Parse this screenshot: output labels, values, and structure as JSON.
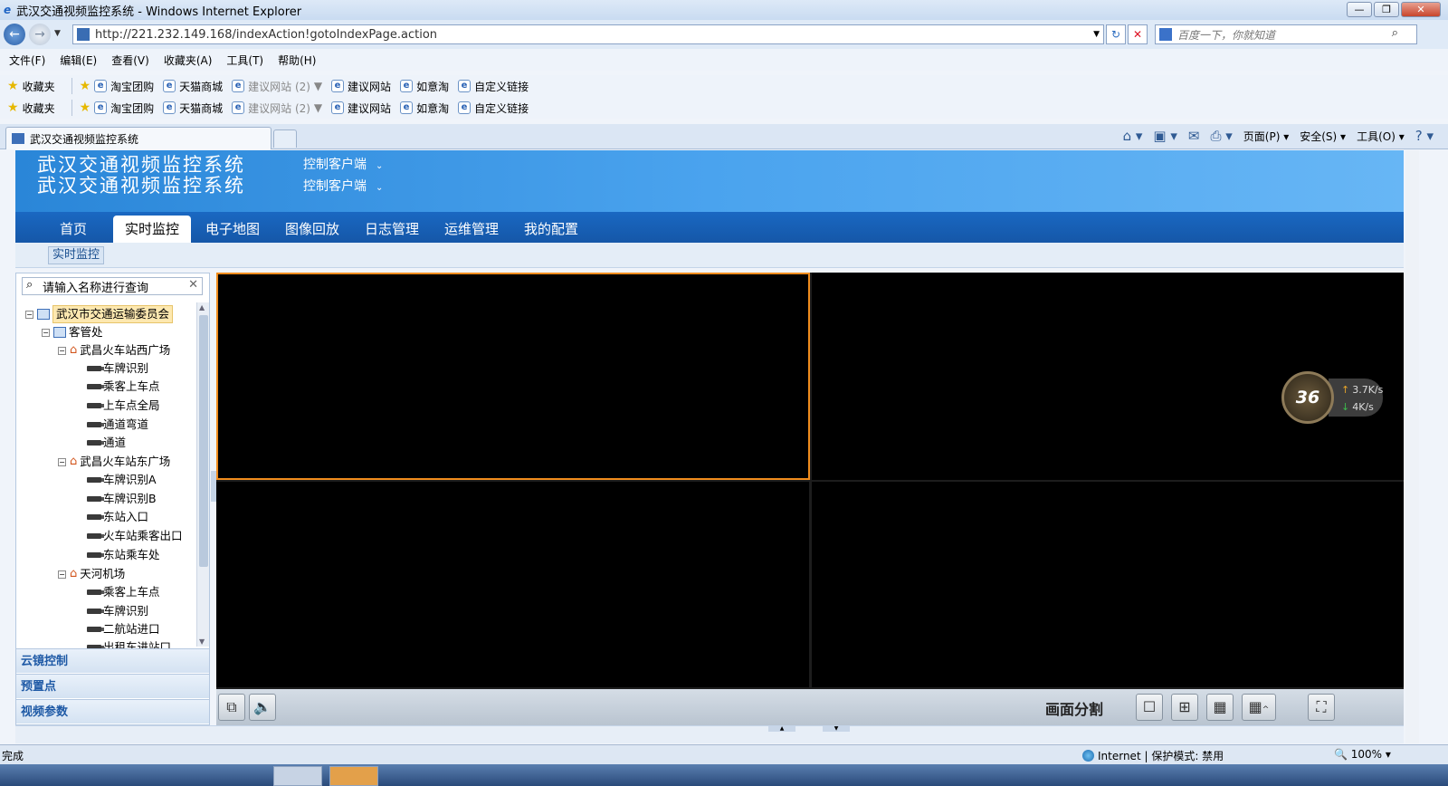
{
  "window": {
    "title": "武汉交通视频监控系统 - Windows Internet Explorer",
    "url": "http://221.232.149.168/indexAction!gotoIndexPage.action",
    "search_placeholder": "百度一下，你就知道"
  },
  "menubar": [
    "文件(F)",
    "编辑(E)",
    "查看(V)",
    "收藏夹(A)",
    "工具(T)",
    "帮助(H)"
  ],
  "favorites": {
    "label": "收藏夹",
    "items": [
      "淘宝团购",
      "天猫商城",
      "建议网站 (2)",
      "建议网站",
      "如意淘",
      "自定义链接"
    ]
  },
  "tab": {
    "title": "武汉交通视频监控系统"
  },
  "commandbar": [
    "页面(P)",
    "安全(S)",
    "工具(O)"
  ],
  "app": {
    "system_name": "武汉交通视频监控系统",
    "client_label": "控制客户端",
    "nav_tabs": [
      "首页",
      "实时监控",
      "电子地图",
      "图像回放",
      "日志管理",
      "运维管理",
      "我的配置"
    ],
    "active_tab": "实时监控",
    "sub_tab": "实时监控"
  },
  "tree": {
    "search_placeholder": "请输入名称进行查询",
    "root": "武汉市交通运输委员会",
    "l1": "客管处",
    "groups": [
      {
        "name": "武昌火车站西广场",
        "cams": [
          "车牌识别",
          "乘客上车点",
          "上车点全局",
          "通道弯道",
          "通道"
        ]
      },
      {
        "name": "武昌火车站东广场",
        "cams": [
          "车牌识别A",
          "车牌识别B",
          "东站入口",
          "火车站乘客出口",
          "东站乘车处"
        ]
      },
      {
        "name": "天河机场",
        "cams": [
          "乘客上车点",
          "车牌识别",
          "二航站进口",
          "出租车进站口"
        ]
      }
    ]
  },
  "accordion": [
    "云镜控制",
    "预置点",
    "视频参数"
  ],
  "controls": {
    "split_label": "画面分割"
  },
  "float_widget": {
    "badge": "36",
    "up": "3.7K/s",
    "down": "4K/s"
  },
  "status": {
    "left": "完成",
    "zone": "Internet | 保护模式: 禁用",
    "zoom": "100%"
  }
}
